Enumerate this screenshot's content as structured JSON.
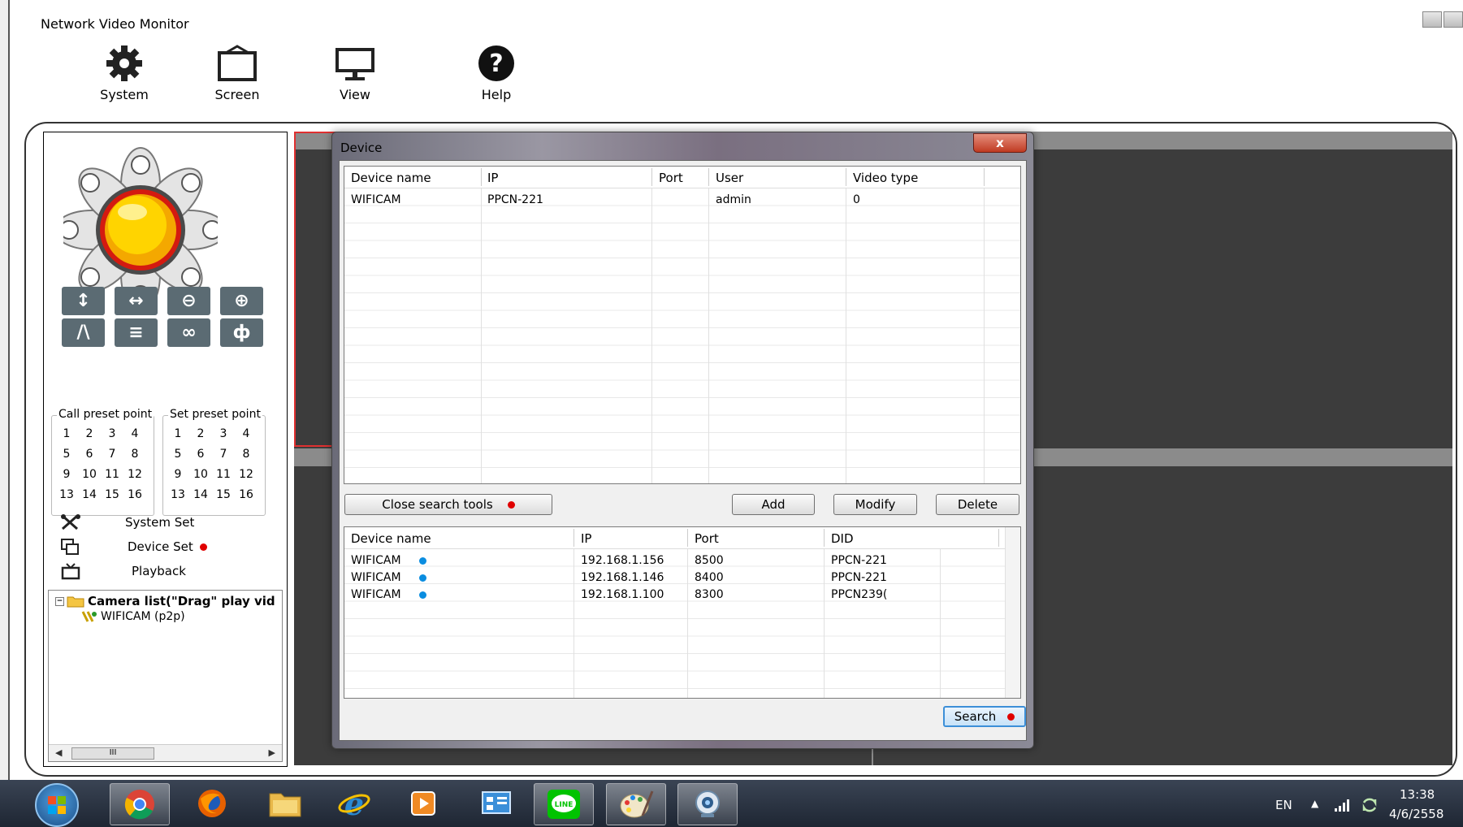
{
  "app": {
    "title": "Network Video Monitor",
    "toolbar": [
      {
        "label": "System",
        "icon": "gear-icon"
      },
      {
        "label": "Screen",
        "icon": "screen-icon"
      },
      {
        "label": "View",
        "icon": "monitor-icon"
      },
      {
        "label": "Help",
        "icon": "help-icon"
      }
    ]
  },
  "left_panel": {
    "call_preset_label": "Call preset point",
    "set_preset_label": "Set preset point",
    "presets": [
      "1",
      "2",
      "3",
      "4",
      "5",
      "6",
      "7",
      "8",
      "9",
      "10",
      "11",
      "12",
      "13",
      "14",
      "15",
      "16"
    ],
    "menu": {
      "system_set": "System Set",
      "device_set": "Device Set",
      "playback": "Playback"
    },
    "tree": {
      "root": "Camera list(\"Drag\" play vid",
      "child": "WIFICAM (p2p)",
      "scroll_thumb": "III"
    }
  },
  "dialog": {
    "title": "Device",
    "close": "x",
    "top_headers": [
      "Device name",
      "IP",
      "Port",
      "User",
      "Video type"
    ],
    "top_rows": [
      {
        "device_name": "WIFICAM",
        "ip": "PPCN-221",
        "port": "",
        "user": "admin",
        "video_type": "0"
      }
    ],
    "buttons": {
      "close_search": "Close search tools",
      "add": "Add",
      "modify": "Modify",
      "delete": "Delete",
      "search": "Search"
    },
    "bottom_headers": [
      "Device name",
      "IP",
      "Port",
      "DID"
    ],
    "bottom_rows": [
      {
        "device_name": "WIFICAM",
        "ip": "192.168.1.156",
        "port": "8500",
        "did": "PPCN-221"
      },
      {
        "device_name": "WIFICAM",
        "ip": "192.168.1.146",
        "port": "8400",
        "did": "PPCN-221"
      },
      {
        "device_name": "WIFICAM",
        "ip": "192.168.1.100",
        "port": "8300",
        "did": "PPCN239("
      }
    ]
  },
  "taskbar": {
    "apps": [
      "chrome-icon",
      "firefox-icon",
      "file-explorer-icon",
      "ie-icon",
      "media-player-icon",
      "control-panel-icon",
      "line-icon",
      "paint-icon",
      "network-video-monitor-icon"
    ],
    "lang": "EN",
    "time": "13:38",
    "date": "4/6/2558"
  },
  "colors": {
    "accent_red": "#e00000",
    "accent_blue": "#0a8de0",
    "ctrl_btn": "#5b6b73"
  }
}
